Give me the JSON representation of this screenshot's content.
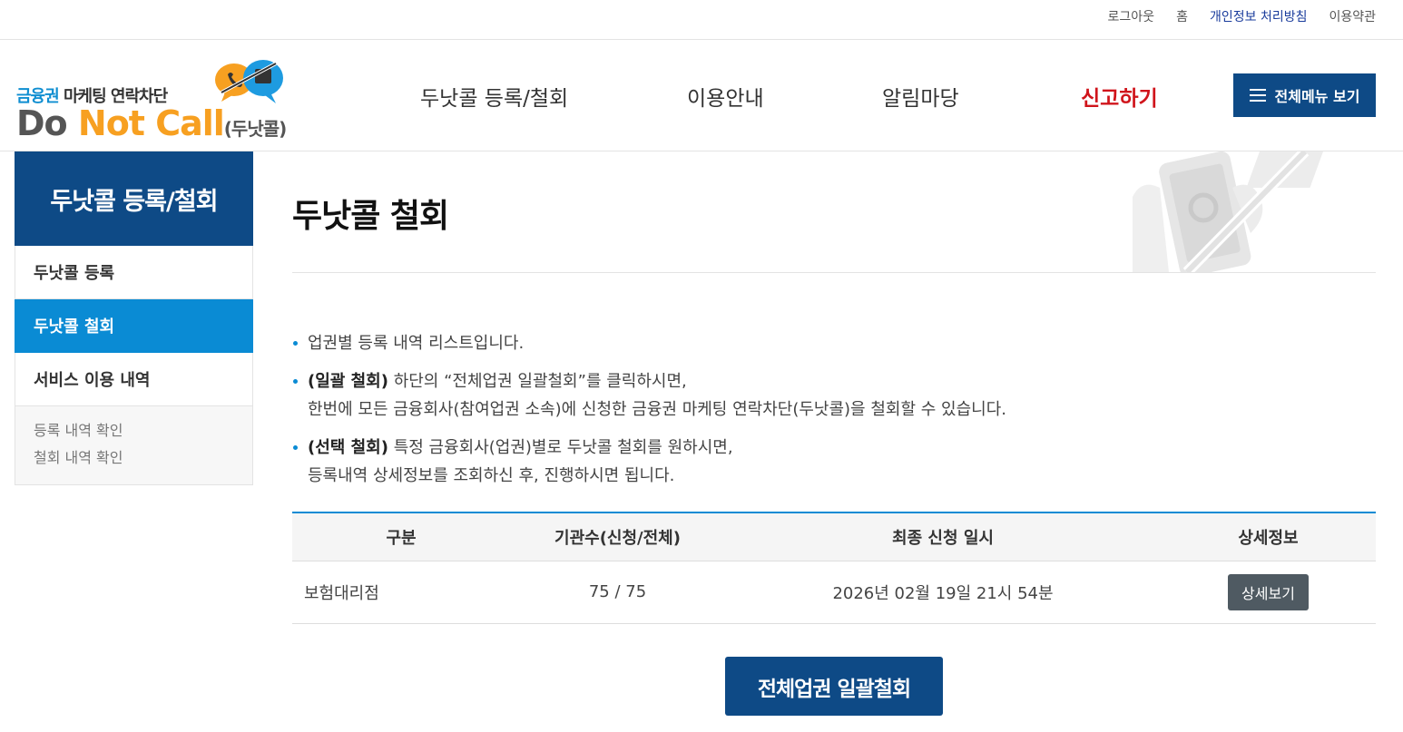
{
  "util_links": {
    "logout": "로그아웃",
    "home": "홈",
    "privacy": "개인정보 처리방침",
    "terms": "이용약관"
  },
  "logo": {
    "sub_highlight": "금융권",
    "sub_rest": " 마케팅 연락차단",
    "main_do": "Do ",
    "main_notcall": "Not Call",
    "main_small": "(두낫콜)"
  },
  "nav": {
    "items": [
      "두낫콜 등록/철회",
      "이용안내",
      "알림마당",
      "신고하기"
    ],
    "all_menu": "전체메뉴 보기"
  },
  "sidebar": {
    "title": "두낫콜 등록/철회",
    "items": [
      "두낫콜 등록",
      "두낫콜 철회",
      "서비스 이용 내역"
    ],
    "sub_items": [
      "등록 내역 확인",
      "철회 내역 확인"
    ]
  },
  "page": {
    "title": "두낫콜 철회",
    "bullet1": "업권별 등록 내역 리스트입니다.",
    "bullet2_bold": "(일괄 철회)",
    "bullet2_text": " 하단의 “전체업권 일괄철회”를 클릭하시면,",
    "bullet2_line2": "한번에 모든 금융회사(참여업권 소속)에 신청한 금융권 마케팅 연락차단(두낫콜)을 철회할 수 있습니다.",
    "bullet3_bold": "(선택 철회)",
    "bullet3_text": " 특정 금융회사(업권)별로 두낫콜 철회를 원하시면,",
    "bullet3_line2": "등록내역 상세정보를 조회하신 후, 진행하시면 됩니다."
  },
  "table": {
    "headers": [
      "구분",
      "기관수(신청/전체)",
      "최종 신청 일시",
      "상세정보"
    ],
    "rows": [
      {
        "category": "보험대리점",
        "count": "75 / 75",
        "datetime": "2026년 02월 19일 21시 54분",
        "button": "상세보기"
      }
    ]
  },
  "bulk_button": "전체업권 일괄철회",
  "colors": {
    "primary_navy": "#0e4a86",
    "accent_blue": "#0a8bd4",
    "report_red": "#d0141b",
    "logo_orange": "#f7a021"
  }
}
